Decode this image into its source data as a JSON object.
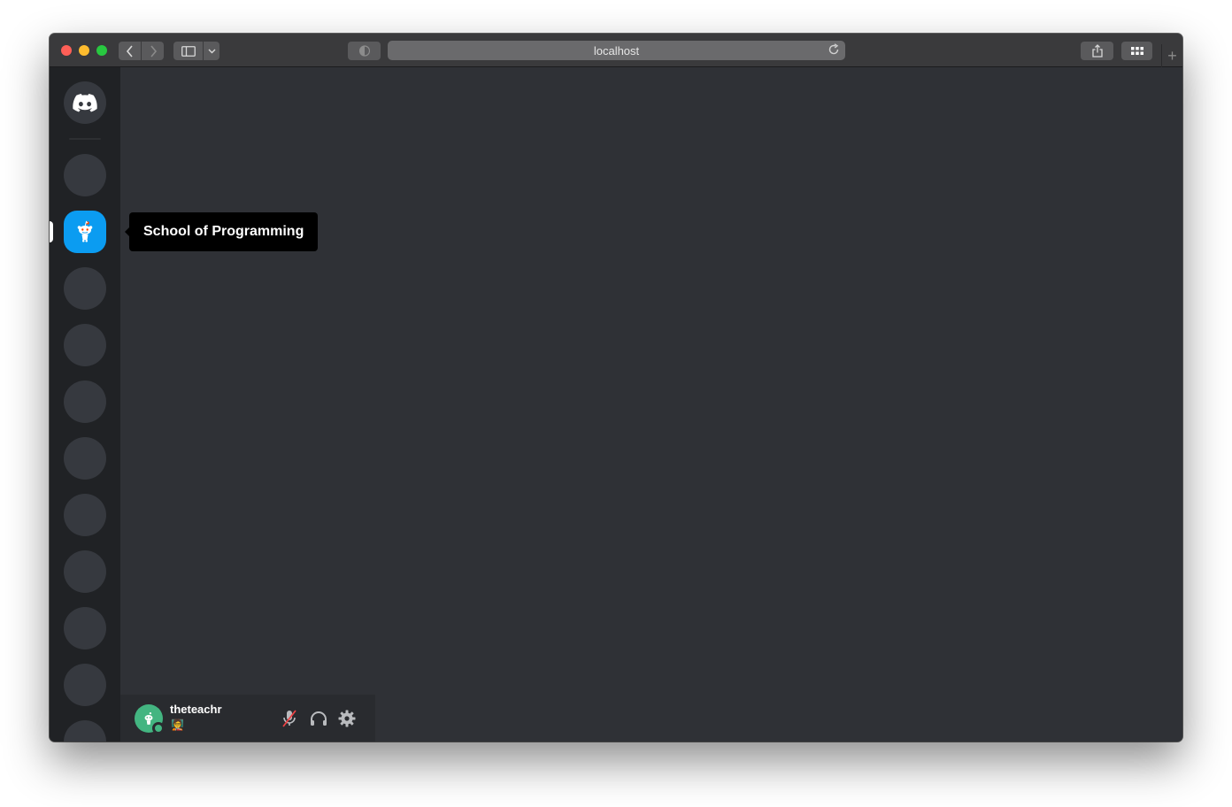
{
  "browser": {
    "url": "localhost",
    "traffic_lights": [
      "close",
      "minimize",
      "zoom"
    ],
    "icons": {
      "back": "chevron-left-icon",
      "forward": "chevron-right-icon",
      "sidebar": "sidebar-icon",
      "sidebar_menu": "chevron-down-icon",
      "privacy": "shield-icon",
      "reload": "reload-icon",
      "share": "share-icon",
      "tabs": "tab-overview-icon",
      "new_tab": "plus-icon"
    },
    "new_tab_glyph": "+"
  },
  "guilds": {
    "home_icon": "discord-logo-icon",
    "active_guild_icon": "reddit-alien-icon",
    "active_guild_color": "#0b9cf1",
    "placeholder_color": "#36393f",
    "tooltip": "School of Programming"
  },
  "user": {
    "username": "theteachr",
    "status": "online",
    "status_color": "#43b581",
    "custom_status_emoji": "🧑‍🏫",
    "controls": {
      "mute": "microphone-muted-icon",
      "deafen": "headphones-icon",
      "settings": "gear-icon"
    }
  },
  "colors": {
    "rail_bg": "#202225",
    "main_bg": "#2f3136",
    "panel_bg": "#292b2f"
  }
}
